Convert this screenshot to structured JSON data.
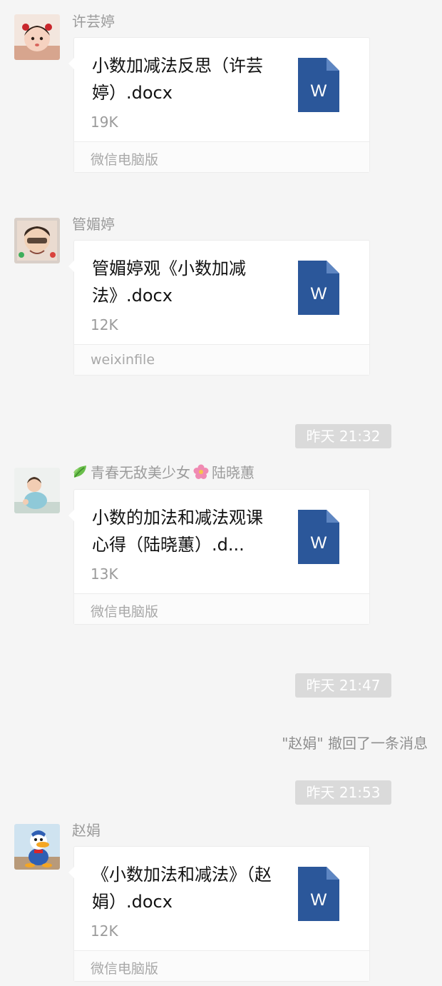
{
  "messages": [
    {
      "sender": "许芸婷",
      "file_name": "小数加减法反思（许芸婷）.docx",
      "file_size": "19K",
      "source": "微信电脑版",
      "file_icon": "word-doc-icon",
      "file_icon_letter": "W"
    },
    {
      "sender": "管媚婷",
      "file_name": "管媚婷观《小数加减法》.docx",
      "file_size": "12K",
      "source": "weixinfile",
      "file_icon": "word-doc-icon",
      "file_icon_letter": "W"
    },
    {
      "timestamp": "昨天 21:32"
    },
    {
      "sender_prefix_icon": "leaf-emoji-icon",
      "sender_part1": "青春无敌美少女",
      "sender_middle_icon": "flower-emoji-icon",
      "sender_part2": "陆晓蕙",
      "file_name": "小数的加法和减法观课心得（陆晓蕙）.d...",
      "file_size": "13K",
      "source": "微信电脑版",
      "file_icon": "word-doc-icon",
      "file_icon_letter": "W"
    },
    {
      "timestamp": "昨天 21:47"
    },
    {
      "system_note": "\"赵娟\" 撤回了一条消息"
    },
    {
      "timestamp": "昨天 21:53"
    },
    {
      "sender": "赵娟",
      "file_name": "《小数加法和减法》（赵娟）.docx",
      "file_size": "12K",
      "source": "微信电脑版",
      "file_icon": "word-doc-icon",
      "file_icon_letter": "W"
    }
  ],
  "colors": {
    "background": "#f5f5f5",
    "card": "#ffffff",
    "word_blue": "#2b579a",
    "timestamp_badge": "#dadada",
    "muted_text": "#9b9b9b"
  }
}
